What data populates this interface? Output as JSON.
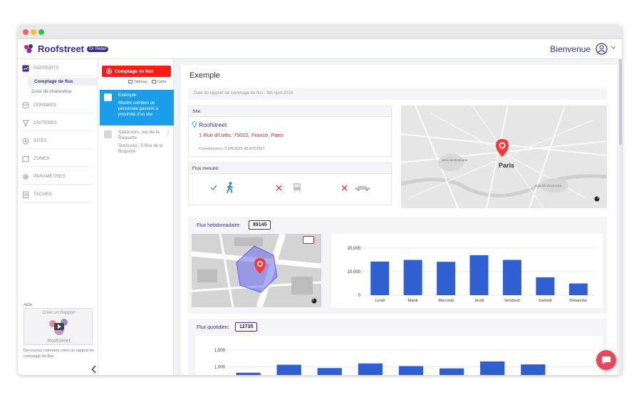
{
  "app": {
    "logo_text": "Roofstreet",
    "logo_badge": "for Retail",
    "welcome": "Bienvenue"
  },
  "sidebar": {
    "items": [
      {
        "label": "RAPPORTS",
        "icon": "chart-icon"
      },
      {
        "label": "DONNEES",
        "icon": "database-icon"
      },
      {
        "label": "CRITERES",
        "icon": "filter-icon"
      },
      {
        "label": "SITES",
        "icon": "location-icon"
      },
      {
        "label": "ZONES",
        "icon": "map-icon"
      },
      {
        "label": "PARAMETRES",
        "icon": "gear-icon"
      },
      {
        "label": "TACHES",
        "icon": "tasks-icon"
      }
    ],
    "subitems": [
      "Comptage de flux",
      "Zone de chalandise"
    ],
    "help": {
      "label": "Aide",
      "video_title": "Créer un Rapport",
      "video_brand": "Roofstreet",
      "text": "Découvrez comment créer un rapport de comptage de flux"
    }
  },
  "list": {
    "new_button": "Comptage de flux",
    "view_table": "Tableau",
    "view_map": "Carte",
    "cards": [
      {
        "title": "Exemple",
        "desc": "Montre combien de personnes passent à proximité d'un site"
      },
      {
        "title": "Starbucks, rue de la Roquette",
        "desc": "Starbucks , 5 Rue de la Roquette"
      }
    ]
  },
  "report": {
    "title": "Exemple",
    "date": "Date du rapport de comptage de flux : 9th April 2019",
    "site_header": "Site:",
    "site_name": "Roofstreet",
    "site_address": "1 Rue d'Uzès, 75002, France, Paris",
    "site_coords": "Coordonnées: 2.3453515 48.8703597",
    "flow_header": "Flux mesuré:",
    "flow_modes": [
      {
        "mode": "pedestrian",
        "icon": "walking-icon",
        "status": "check-icon"
      },
      {
        "mode": "train",
        "icon": "train-icon",
        "status": "cross-icon"
      },
      {
        "mode": "car",
        "icon": "car-icon",
        "status": "cross-icon"
      }
    ],
    "map": {
      "city": "Paris",
      "labels": [
        "Bois de Boulogne",
        "Bois de Vincennes"
      ]
    },
    "weekly": {
      "label": "Flux hebdomadaire:",
      "value": "89145"
    },
    "daily": {
      "label": "Flux quotidien:",
      "value": "12735"
    }
  },
  "colors": {
    "brand": "#3b2b8f",
    "accent_red": "#ff1a1a",
    "bar": "#2f5fd0",
    "selected": "#1a9eea"
  },
  "chart_data": [
    {
      "type": "bar",
      "categories": [
        "Lundi",
        "Mardi",
        "Mercredi",
        "Jeudi",
        "Vendredi",
        "Samedi",
        "Dimanche"
      ],
      "values": [
        14300,
        15000,
        14200,
        17000,
        15000,
        7600,
        5000
      ],
      "yticks": [
        "0",
        "10,000",
        "20,000"
      ],
      "ylim": [
        0,
        20000
      ]
    },
    {
      "type": "bar",
      "categories": [
        "",
        "",
        "",
        "",
        "",
        "",
        "",
        "",
        ""
      ],
      "values": [
        820,
        1060,
        960,
        1100,
        1020,
        950,
        1160,
        1070,
        0
      ],
      "yticks": [
        "1,000",
        "1,500"
      ],
      "ylim": [
        600,
        1500
      ]
    }
  ]
}
